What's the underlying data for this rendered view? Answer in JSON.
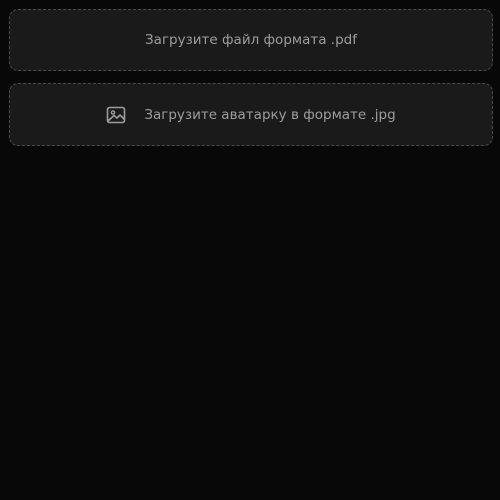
{
  "upload_pdf": {
    "label": "Загрузите файл формата .pdf"
  },
  "upload_avatar": {
    "label": "Загрузите аватарку в формате .jpg",
    "icon": "image-icon"
  },
  "colors": {
    "background": "#080808",
    "dropzone_bg": "#1a1a1a",
    "dropzone_border": "#4a4a4a",
    "text": "#9d9d9d"
  }
}
